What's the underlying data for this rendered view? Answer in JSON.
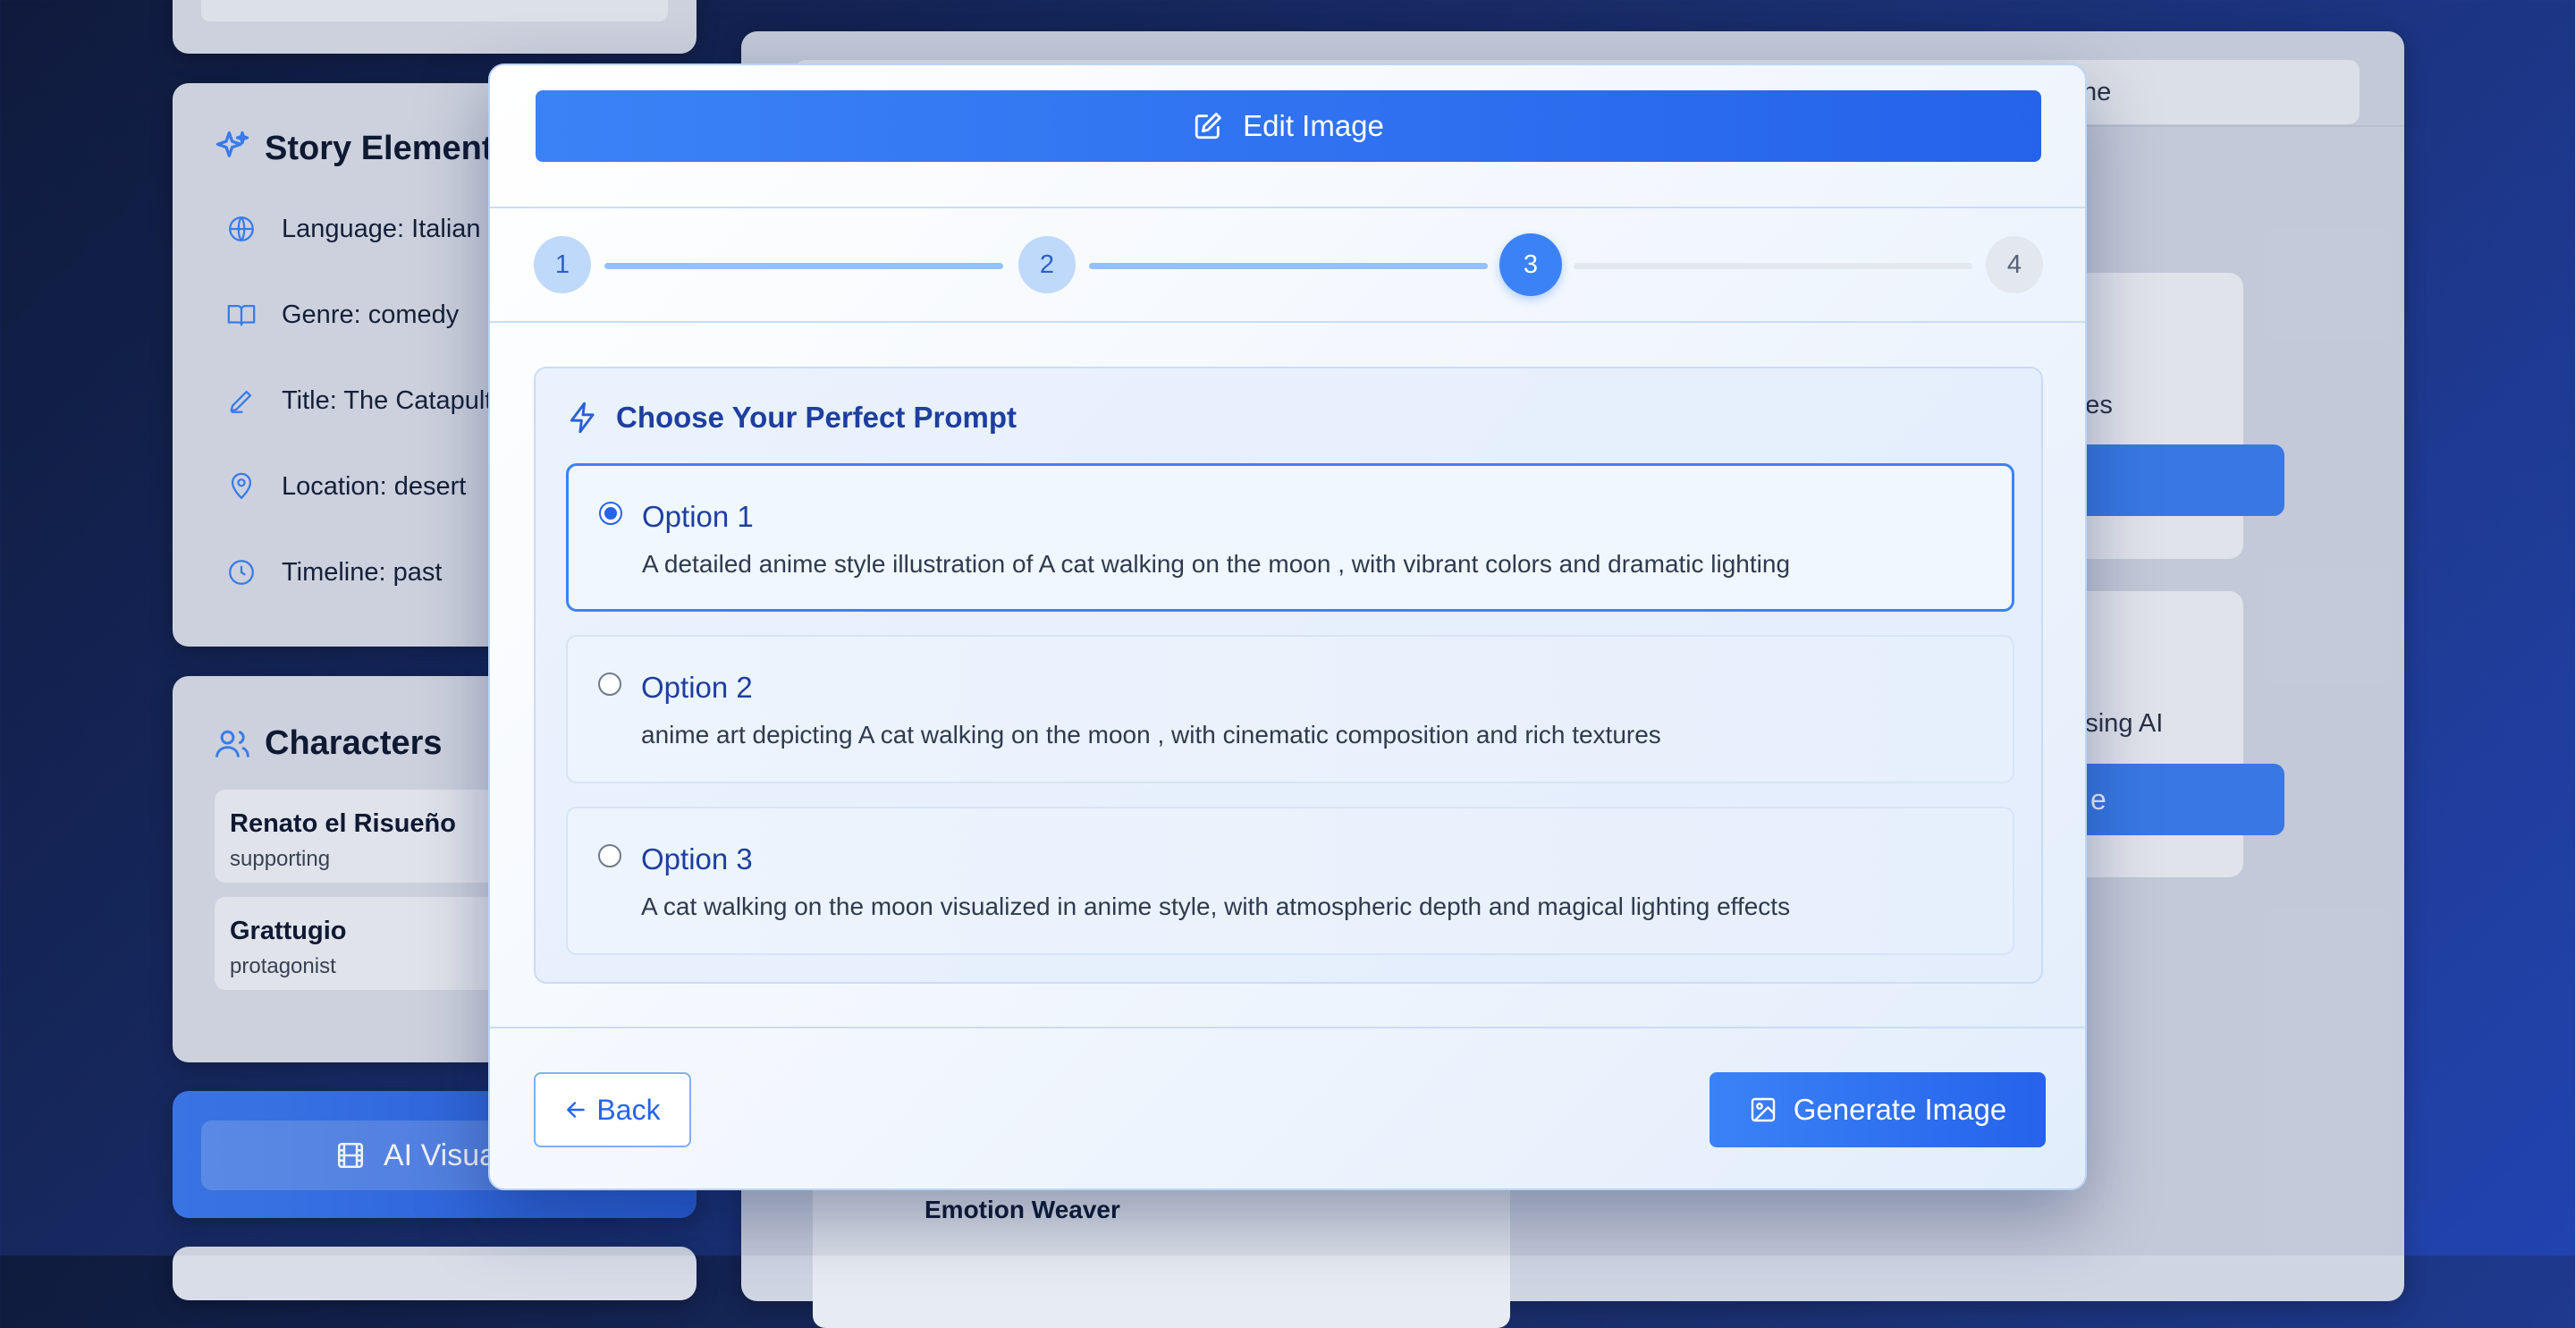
{
  "background": {
    "story_elements": {
      "title": "Story Elements",
      "items": [
        {
          "icon": "globe-icon",
          "text": "Language: Italian"
        },
        {
          "icon": "book-open-icon",
          "text": "Genre: comedy"
        },
        {
          "icon": "pencil-icon",
          "text": "Title: The Catapult"
        },
        {
          "icon": "map-pin-icon",
          "text": "Location: desert"
        },
        {
          "icon": "clock-icon",
          "text": "Timeline: past"
        }
      ]
    },
    "characters": {
      "title": "Characters",
      "items": [
        {
          "name": "Renato el Risueño",
          "role": "supporting"
        },
        {
          "name": "Grattugio",
          "role": "protagonist"
        }
      ]
    },
    "ai_visual_button": "AI Visual S",
    "main": {
      "tab_stub": "ne",
      "card1_desc": "ages",
      "card2_desc": "t using AI",
      "card2_button": "e",
      "emotion_label": "Emotion Weaver"
    }
  },
  "modal": {
    "header_button": "Edit Image",
    "steps": [
      "1",
      "2",
      "3",
      "4"
    ],
    "current_step": 3,
    "prompt_heading": "Choose Your Perfect Prompt",
    "options": [
      {
        "title": "Option 1",
        "text": "A detailed anime style illustration of A cat walking on the moon , with vibrant colors and dramatic lighting",
        "selected": true
      },
      {
        "title": "Option 2",
        "text": "anime art depicting A cat walking on the moon , with cinematic composition and rich textures",
        "selected": false
      },
      {
        "title": "Option 3",
        "text": "A cat walking on the moon visualized in anime style, with atmospheric depth and magical lighting effects",
        "selected": false
      }
    ],
    "back_button": "Back",
    "generate_button": "Generate Image"
  },
  "colors": {
    "accent": "#3b82f6",
    "accent_dark": "#2563eb",
    "heading_blue": "#1e3fa0",
    "step_done": "#bfd9fb",
    "step_todo": "#e3e7ee"
  }
}
